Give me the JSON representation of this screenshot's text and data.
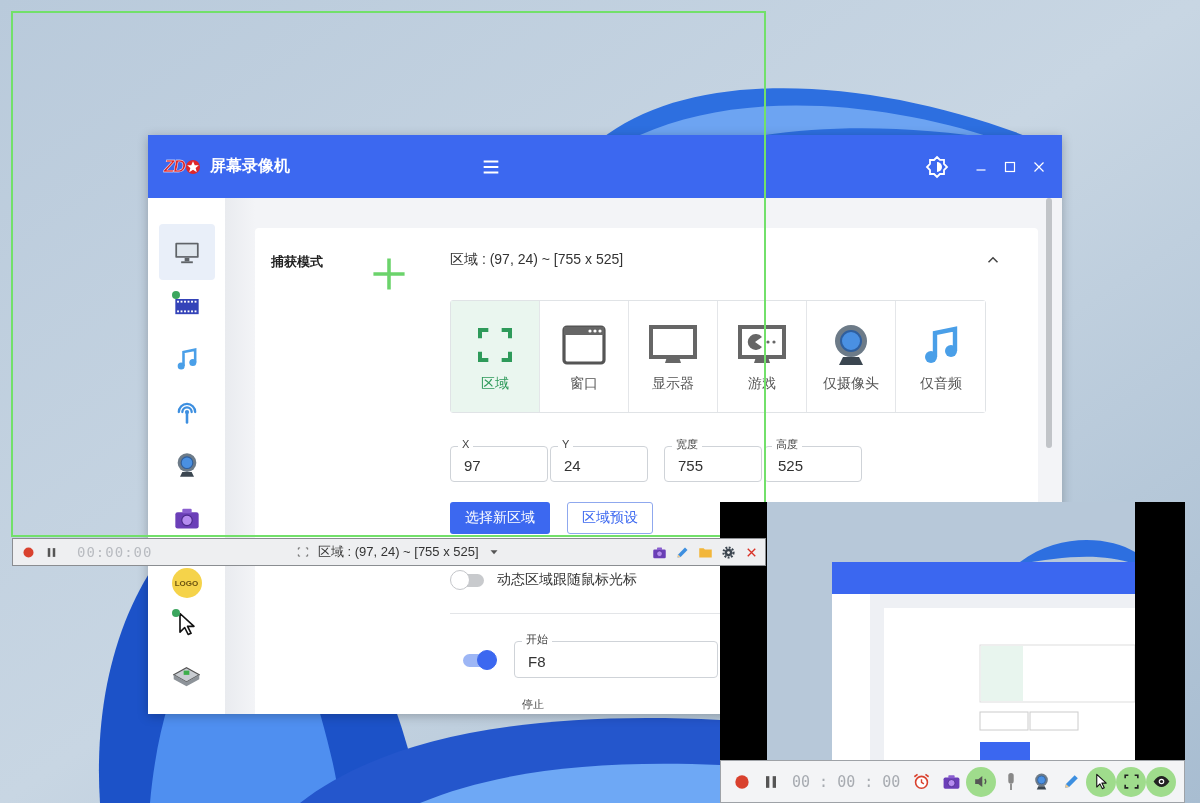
{
  "app": {
    "logo": "ZD",
    "title": "屏幕录像机"
  },
  "sidebar": {
    "items": [
      {
        "kind": "monitor",
        "selected": true,
        "dot": false
      },
      {
        "kind": "film",
        "selected": false,
        "dot": true
      },
      {
        "kind": "music",
        "selected": false,
        "dot": false
      },
      {
        "kind": "antenna",
        "selected": false,
        "dot": false
      },
      {
        "kind": "webcam",
        "selected": false,
        "dot": false
      },
      {
        "kind": "camera",
        "selected": false,
        "dot": false
      },
      {
        "kind": "logo",
        "label": "LOGO",
        "selected": false,
        "dot": false
      },
      {
        "kind": "cursor",
        "selected": false,
        "dot": true
      },
      {
        "kind": "keys",
        "selected": false,
        "dot": false
      }
    ]
  },
  "capture": {
    "label": "捕获模式",
    "summary": "区域 : (97, 24) ~ [755 x 525]",
    "expanded": true,
    "modes": [
      {
        "kind": "region",
        "label": "区域",
        "selected": true
      },
      {
        "kind": "window",
        "label": "窗口",
        "selected": false
      },
      {
        "kind": "display",
        "label": "显示器",
        "selected": false
      },
      {
        "kind": "game",
        "label": "游戏",
        "selected": false
      },
      {
        "kind": "webcam",
        "label": "仅摄像头",
        "selected": false
      },
      {
        "kind": "music",
        "label": "仅音频",
        "selected": false
      }
    ],
    "fields": [
      {
        "label": "X",
        "value": "97"
      },
      {
        "label": "Y",
        "value": "24"
      },
      {
        "label": "宽度",
        "value": "755"
      },
      {
        "label": "高度",
        "value": "525"
      }
    ],
    "buttons": [
      {
        "kind": "primary",
        "label": "选择新区域"
      },
      {
        "kind": "outline",
        "label": "区域预设"
      }
    ],
    "follow_mouse": {
      "label": "动态区域跟随鼠标光标",
      "on": false
    }
  },
  "hotkeys": [
    {
      "label": "开始",
      "value": "F8",
      "on": true
    }
  ],
  "next_label": "停止",
  "record_bar": {
    "time": "00:00:00",
    "summary": "区域 : (97, 24) ~ [755 x 525]",
    "tools": [
      {
        "kind": "camera"
      },
      {
        "kind": "pencil"
      },
      {
        "kind": "folder"
      },
      {
        "kind": "gear"
      },
      {
        "kind": "close"
      }
    ]
  },
  "preview": {
    "kind": "picture",
    "time": "00 : 00 : 00",
    "tools": [
      {
        "kind": "alarm"
      },
      {
        "kind": "camera"
      },
      {
        "kind": "speaker",
        "on": true
      },
      {
        "kind": "mic",
        "on": false
      },
      {
        "kind": "webcam",
        "on": false
      },
      {
        "kind": "pencil"
      },
      {
        "kind": "cursor",
        "on": true
      },
      {
        "kind": "fullscreen",
        "on": true
      },
      {
        "kind": "eye",
        "on": true
      }
    ]
  }
}
